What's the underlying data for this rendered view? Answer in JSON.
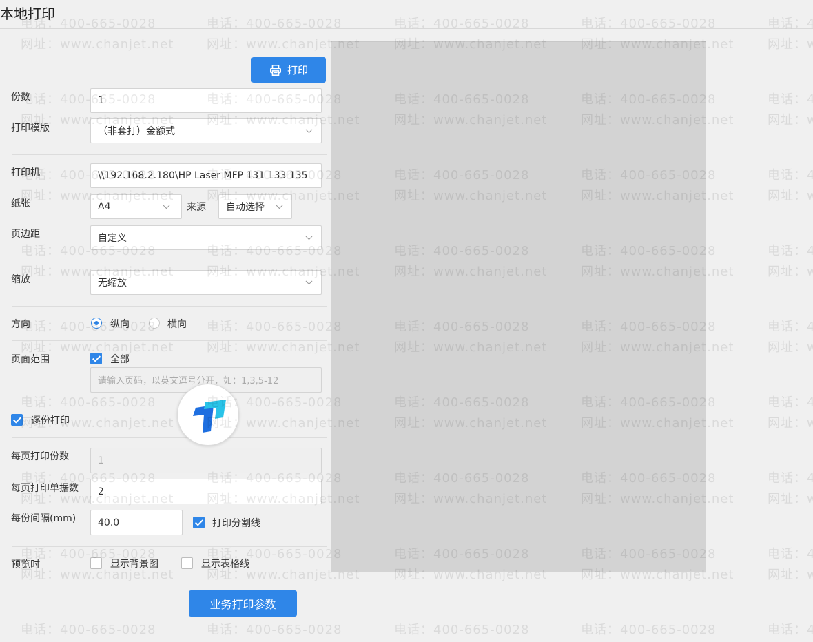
{
  "window": {
    "title": "本地打印"
  },
  "toolbar": {
    "print_label": "打印"
  },
  "form": {
    "copies_label": "份数",
    "copies_value": "1",
    "template_label": "打印模版",
    "template_value": "（非套打）金额式",
    "printer_label": "打印机",
    "printer_value": "\\\\192.168.2.180\\HP Laser MFP 131 133 135",
    "paper_label": "纸张",
    "paper_value": "A4",
    "source_label": "来源",
    "source_value": "自动选择",
    "margin_label": "页边距",
    "margin_value": "自定义",
    "scale_label": "缩放",
    "scale_value": "无缩放",
    "orientation_label": "方向",
    "orientation_portrait": "纵向",
    "orientation_landscape": "横向",
    "page_range_label": "页面范围",
    "page_range_all": "全部",
    "page_range_placeholder": "请输入页码，以英文逗号分开，如：1,3,5-12",
    "collate_label": "逐份打印",
    "copies_per_page_label": "每页打印份数",
    "copies_per_page_value": "1",
    "docs_per_page_label": "每页打印单据数",
    "docs_per_page_value": "2",
    "gap_label": "每份间隔(mm)",
    "gap_value": "40.0",
    "print_divider_label": "打印分割线",
    "preview_label": "预览时",
    "show_background_label": "显示背景图",
    "show_gridlines_label": "显示表格线"
  },
  "state": {
    "orientation": "portrait",
    "page_range_all": true,
    "collate": true,
    "print_divider": true,
    "show_background": false,
    "show_gridlines": false
  },
  "footer": {
    "business_params_label": "业务打印参数"
  },
  "watermark": {
    "phone": "电话：400-665-0028",
    "site": "网址：www.chanjet.net"
  },
  "colors": {
    "accent": "#2f86e8",
    "preview_bg": "#d3d3d3",
    "page_bg": "#f0f0f0"
  }
}
